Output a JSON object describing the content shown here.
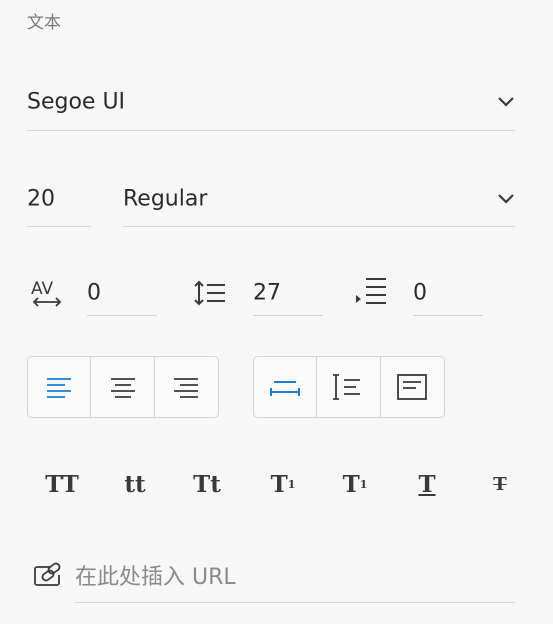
{
  "section": {
    "title": "文本"
  },
  "font": {
    "family": "Segoe UI",
    "size": "20",
    "weight": "Regular"
  },
  "spacing": {
    "character": "0",
    "line": "27",
    "paragraph": "0"
  },
  "align": {
    "active": "left",
    "accent": "#1a7fd4"
  },
  "styles": {
    "allcaps": "TT",
    "lowercase": "tt",
    "titlecase": "Tt",
    "superscript_base": "T",
    "superscript_mark": "1",
    "subscript_base": "T",
    "subscript_mark": "1",
    "underline": "T",
    "strike": "T"
  },
  "link": {
    "placeholder": "在此处插入 URL"
  }
}
